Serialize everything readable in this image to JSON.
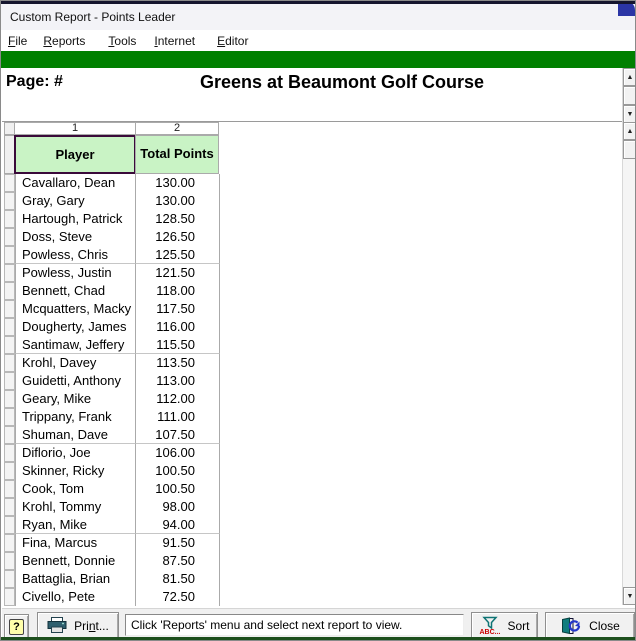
{
  "window": {
    "title": "Custom Report - Points Leader"
  },
  "menu_bar": {
    "items": [
      {
        "label": "File",
        "mn": "F",
        "post": "ile"
      },
      {
        "label": "Reports",
        "mn": "R",
        "post": "eports"
      },
      {
        "label": "Tools",
        "mn": "T",
        "post": "ools"
      },
      {
        "label": "Internet",
        "mn": "I",
        "post": "nternet"
      },
      {
        "label": "Editor",
        "mn": "E",
        "post": "ditor"
      }
    ]
  },
  "report_header": {
    "page_label": "Page: #",
    "title": "Greens at Beaumont Golf Course"
  },
  "grid": {
    "column_numbers": [
      "1",
      "2"
    ],
    "column_headers": [
      "Player",
      "Total Points"
    ],
    "rows": [
      {
        "player": "Cavallaro, Dean",
        "points": "130.00"
      },
      {
        "player": "Gray, Gary",
        "points": "130.00"
      },
      {
        "player": "Hartough, Patrick",
        "points": "128.50"
      },
      {
        "player": "Doss, Steve",
        "points": "126.50"
      },
      {
        "player": "Powless, Chris",
        "points": "125.50"
      },
      {
        "player": "Powless, Justin",
        "points": "121.50"
      },
      {
        "player": "Bennett, Chad",
        "points": "118.00"
      },
      {
        "player": "Mcquatters, Macky",
        "points": "117.50"
      },
      {
        "player": "Dougherty, James",
        "points": "116.00"
      },
      {
        "player": "Santimaw, Jeffery",
        "points": "115.50"
      },
      {
        "player": "Krohl, Davey",
        "points": "113.50"
      },
      {
        "player": "Guidetti, Anthony",
        "points": "113.00"
      },
      {
        "player": "Geary, Mike",
        "points": "112.00"
      },
      {
        "player": "Trippany, Frank",
        "points": "111.00"
      },
      {
        "player": "Shuman, Dave",
        "points": "107.50"
      },
      {
        "player": "Diflorio, Joe",
        "points": "106.00"
      },
      {
        "player": "Skinner, Ricky",
        "points": "100.50"
      },
      {
        "player": "Cook, Tom",
        "points": "100.50"
      },
      {
        "player": "Krohl, Tommy",
        "points": "98.00"
      },
      {
        "player": "Ryan, Mike",
        "points": "94.00"
      },
      {
        "player": "Fina, Marcus",
        "points": "91.50"
      },
      {
        "player": "Bennett, Donnie",
        "points": "87.50"
      },
      {
        "player": "Battaglia, Brian",
        "points": "81.50"
      },
      {
        "player": "Civello, Pete",
        "points": "72.50"
      }
    ]
  },
  "status_bar": {
    "help_glyph": "?",
    "print": {
      "pre": "Pri",
      "mn": "n",
      "post": "t..."
    },
    "message": "Click 'Reports' menu and select next report to view.",
    "sort_label": "Sort",
    "sort_icon_caption": "ABC...",
    "close_label": "Close"
  },
  "scrollbar": {
    "up_glyph": "▲",
    "down_glyph": "▼"
  },
  "colors": {
    "accent_green": "#008000",
    "header_cell_green": "#c9f3c5",
    "selection_border": "#3a0a3a",
    "sort_caption_red": "#cc0000",
    "icon_teal": "#0e7474",
    "corner_blue": "#2b35a5"
  }
}
